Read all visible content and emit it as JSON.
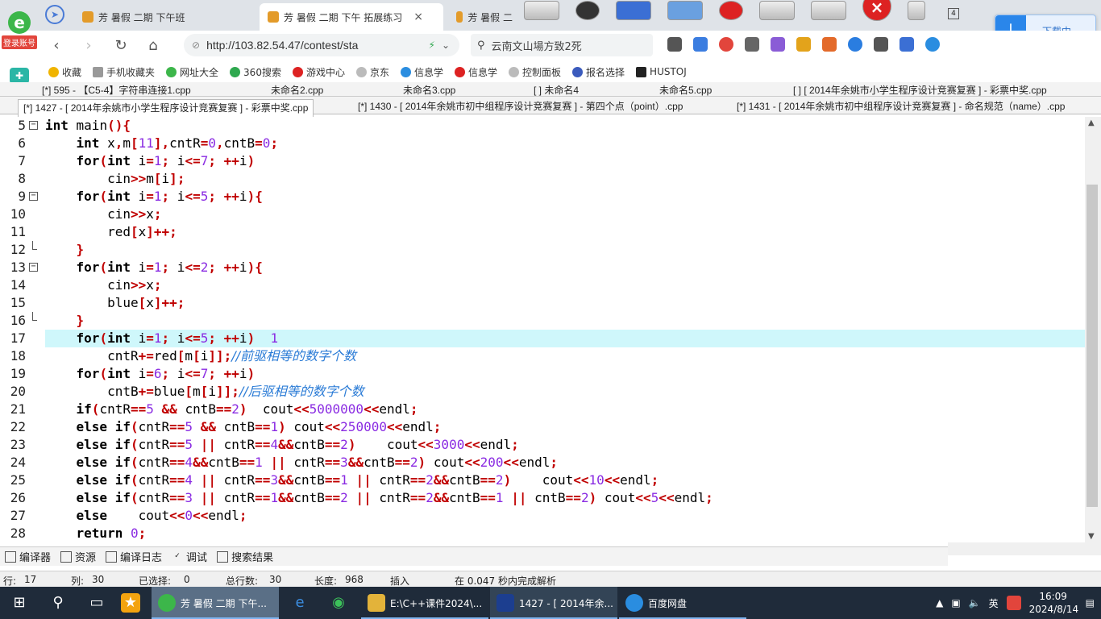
{
  "browser": {
    "login_badge": "登录账号",
    "tabs": [
      {
        "label": "芳 暑假 二期 下午班",
        "active": false
      },
      {
        "label": "芳 暑假 二期 下午 拓展练习",
        "active": true
      },
      {
        "label": "芳 暑假 二",
        "active": false
      }
    ],
    "close_glyph": "×",
    "window_count": "4",
    "download_label": "下载中...",
    "url": "http://103.82.54.47/contest/sta",
    "search_text": "云南文山場方致2死",
    "bookmarks": [
      "收藏",
      "手机收藏夹",
      "网址大全",
      "360搜索",
      "游戏中心",
      "京东",
      "信息学",
      "信息学",
      "控制面板",
      "报名选择",
      "HUSTOJ"
    ]
  },
  "ide": {
    "file_tabs_row1": [
      "[*] 595 - 【C5-4】字符串连接1.cpp",
      "未命名2.cpp",
      "未命名3.cpp",
      "[ ] 未命名4",
      "未命名5.cpp",
      "[ ] [ 2014年余姚市小学生程序设计竞赛复赛 ] - 彩票中奖.cpp"
    ],
    "file_tabs_row2": [
      "[*] 1427 - [ 2014年余姚市小学生程序设计竞赛复赛 ] - 彩票中奖.cpp",
      "[*] 1430 - [ 2014年余姚市初中组程序设计竞赛复赛 ] - 第四个点（point）.cpp",
      "[*] 1431 - [ 2014年余姚市初中组程序设计竞赛复赛 ] - 命名规范（name）.cpp"
    ],
    "code_lines": [
      {
        "n": "5",
        "fold": "open",
        "code": "int main(){"
      },
      {
        "n": "6",
        "fold": "",
        "code": "    int x,m[11],cntR=0,cntB=0;"
      },
      {
        "n": "7",
        "fold": "",
        "code": "    for(int i=1; i<=7; ++i)"
      },
      {
        "n": "8",
        "fold": "",
        "code": "        cin>>m[i];"
      },
      {
        "n": "9",
        "fold": "open",
        "code": "    for(int i=1; i<=5; ++i){"
      },
      {
        "n": "10",
        "fold": "",
        "code": "        cin>>x;"
      },
      {
        "n": "11",
        "fold": "",
        "code": "        red[x]++;"
      },
      {
        "n": "12",
        "fold": "end",
        "code": "    }"
      },
      {
        "n": "13",
        "fold": "open",
        "code": "    for(int i=1; i<=2; ++i){"
      },
      {
        "n": "14",
        "fold": "",
        "code": "        cin>>x;"
      },
      {
        "n": "15",
        "fold": "",
        "code": "        blue[x]++;"
      },
      {
        "n": "16",
        "fold": "end",
        "code": "    }"
      },
      {
        "n": "17",
        "fold": "",
        "code": "    for(int i=1; i<=5; ++i)  1",
        "current": true
      },
      {
        "n": "18",
        "fold": "",
        "code": "        cntR+=red[m[i]];//前驱相等的数字个数"
      },
      {
        "n": "19",
        "fold": "",
        "code": "    for(int i=6; i<=7; ++i)"
      },
      {
        "n": "20",
        "fold": "",
        "code": "        cntB+=blue[m[i]];//后驱相等的数字个数"
      },
      {
        "n": "21",
        "fold": "",
        "code": "    if(cntR==5 && cntB==2)  cout<<5000000<<endl;"
      },
      {
        "n": "22",
        "fold": "",
        "code": "    else if(cntR==5 && cntB==1) cout<<250000<<endl;"
      },
      {
        "n": "23",
        "fold": "",
        "code": "    else if(cntR==5 || cntR==4&&cntB==2)    cout<<3000<<endl;"
      },
      {
        "n": "24",
        "fold": "",
        "code": "    else if(cntR==4&&cntB==1 || cntR==3&&cntB==2) cout<<200<<endl;"
      },
      {
        "n": "25",
        "fold": "",
        "code": "    else if(cntR==4 || cntR==3&&cntB==1 || cntR==2&&cntB==2)    cout<<10<<endl;"
      },
      {
        "n": "26",
        "fold": "",
        "code": "    else if(cntR==3 || cntR==1&&cntB==2 || cntR==2&&cntB==1 || cntB==2) cout<<5<<endl;"
      },
      {
        "n": "27",
        "fold": "",
        "code": "    else    cout<<0<<endl;"
      },
      {
        "n": "28",
        "fold": "",
        "code": "    return 0;"
      }
    ],
    "bottom_tabs": [
      "编译器",
      "资源",
      "编译日志",
      "调试",
      "搜索结果"
    ],
    "status": {
      "row_label": "行:",
      "row": "17",
      "col_label": "列:",
      "col": "30",
      "sel_label": "已选择:",
      "sel": "0",
      "total_label": "总行数:",
      "total": "30",
      "len_label": "长度:",
      "len": "968",
      "mode": "插入",
      "parse": "在 0.047 秒内完成解析"
    }
  },
  "taskbar": {
    "apps": [
      {
        "label": "芳 暑假 二期 下午...",
        "active": true
      },
      {
        "label": "E:\\C++课件2024\\..."
      },
      {
        "label": "1427 - [ 2014年余..."
      },
      {
        "label": "百度网盘"
      }
    ],
    "ime": "英",
    "time": "16:09",
    "date": "2024/8/14"
  },
  "colors": {
    "current_line": "#cff7fb",
    "operator": "#c00000",
    "comment": "#2a7bd6",
    "taskbar": "#1f2b3a"
  }
}
